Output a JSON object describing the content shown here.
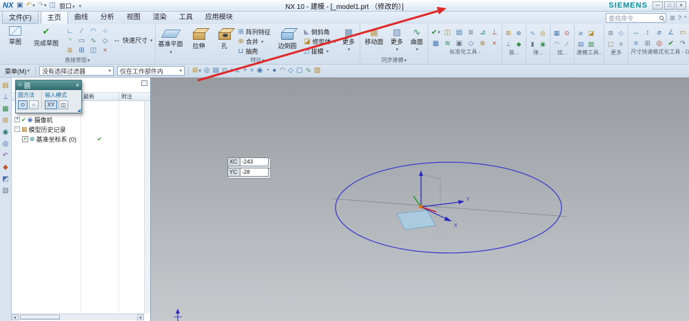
{
  "titlebar": {
    "logo": "NX",
    "quick_icons": [
      {
        "name": "save-icon",
        "glyph": "▣",
        "color": "#4a6fa5"
      },
      {
        "name": "undo-icon",
        "glyph": "↶",
        "color": "#caa23a",
        "caret": true
      },
      {
        "name": "redo-icon",
        "glyph": "↷",
        "color": "#9aa6b4",
        "caret": true
      },
      {
        "name": "window-switch-icon",
        "glyph": "◫",
        "color": "#6a86a8"
      }
    ],
    "window_menu": "窗口",
    "title": "NX 10 - 建模 - [_model1.prt （修改的）]",
    "brand": "SIEMENS",
    "window_controls": [
      {
        "name": "minimize-button",
        "glyph": "─"
      },
      {
        "name": "maximize-button",
        "glyph": "□"
      },
      {
        "name": "close-button",
        "glyph": "×"
      }
    ]
  },
  "tabs": [
    {
      "label": "文件(F)",
      "state": "file"
    },
    {
      "label": "主页",
      "state": "active"
    },
    {
      "label": "曲线",
      "state": ""
    },
    {
      "label": "分析",
      "state": ""
    },
    {
      "label": "视图",
      "state": ""
    },
    {
      "label": "渲染",
      "state": ""
    },
    {
      "label": "工具",
      "state": ""
    },
    {
      "label": "应用模块",
      "state": ""
    }
  ],
  "search": {
    "placeholder": "查找命令"
  },
  "tabrow_icons": [
    {
      "name": "command-finder-icon",
      "glyph": "⊞",
      "color": "#6a7a8a"
    },
    {
      "name": "help-icon",
      "glyph": "?",
      "color": "#4a6fa5"
    },
    {
      "name": "minimize-ribbon-icon",
      "glyph": "^",
      "color": "#6a7a8a"
    }
  ],
  "ribbon": {
    "sketch": {
      "sketch_label": "草图",
      "finish_label": "完成草图",
      "finish_glyph": "✔",
      "quick_dim_label": "快速尺寸",
      "quick_dim_glyph": "↔",
      "group_label": "直接草图",
      "grid_icons": [
        {
          "name": "profile-icon",
          "glyph": "∟",
          "color": "#3a7ab5"
        },
        {
          "name": "line-icon",
          "glyph": "∕",
          "color": "#3a7ab5"
        },
        {
          "name": "arc-icon",
          "glyph": "◠",
          "color": "#3a7ab5"
        },
        {
          "name": "circle-icon",
          "glyph": "○",
          "color": "#3a7ab5"
        },
        {
          "name": "fillet-icon",
          "glyph": "◝",
          "color": "#2a8a4a"
        },
        {
          "name": "rectangle-icon",
          "glyph": "▭",
          "color": "#3a7ab5"
        },
        {
          "name": "studio-spline-icon",
          "glyph": "∿",
          "color": "#2a8a4a"
        },
        {
          "name": "polygon-icon",
          "glyph": "◇",
          "color": "#3a7ab5"
        },
        {
          "name": "offset-curve-icon",
          "glyph": "≣",
          "color": "#b5862a"
        },
        {
          "name": "pattern-curve-icon",
          "glyph": "⊞",
          "color": "#3a7ab5"
        },
        {
          "name": "mirror-curve-icon",
          "glyph": "◫",
          "color": "#3a7ab5"
        },
        {
          "name": "trim-curve-icon",
          "glyph": "×",
          "color": "#b5432a"
        }
      ]
    },
    "feature": {
      "datum_plane": "基准平面",
      "extrude": "拉伸",
      "hole": "孔",
      "pattern": "阵列特征",
      "pattern_glyph": "⊞",
      "unite": "合并",
      "unite_glyph": "⊕",
      "shell": "抽壳",
      "shell_glyph": "⊔",
      "edge_blend": "边倒圆",
      "chamfer": "倒斜角",
      "chamfer_glyph": "◣",
      "trim_body": "修剪体",
      "trim_glyph": "◪",
      "draft": "拔模",
      "draft_glyph": "◿",
      "more": "更多",
      "more_glyph": "▦",
      "group_label": "特征"
    },
    "sync": {
      "move_face": "移动面",
      "move_face_glyph": "▦",
      "more": "更多",
      "more_glyph": "▧",
      "surface": "曲面",
      "surface_glyph": "∿",
      "group_label": "同步建模"
    },
    "std": {
      "group_label": "标准化工具 -",
      "row1": [
        {
          "name": "standard-check-icon",
          "glyph": "✔",
          "color": "#2a8a2a",
          "caret": true
        },
        {
          "name": "replace-template-icon",
          "glyph": "◫",
          "color": "#b5862a"
        },
        {
          "name": "part-family-icon",
          "glyph": "▤",
          "color": "#4a7ab0"
        },
        {
          "name": "attribute-tool-icon",
          "glyph": "≣",
          "color": "#6a7a8a"
        },
        {
          "name": "weld-assistant-icon",
          "glyph": "⊿",
          "color": "#2a7a7a"
        },
        {
          "name": "datum-tool-icon",
          "glyph": "⊥",
          "color": "#b5432a"
        }
      ],
      "row2": [
        {
          "name": "gb-standard-icon",
          "glyph": "▦",
          "color": "#4a7ab0"
        },
        {
          "name": "spline-tool-icon",
          "glyph": "≋",
          "color": "#2a8a4a"
        },
        {
          "name": "annotation-tool-icon",
          "glyph": "▣",
          "color": "#6a7a8a"
        },
        {
          "name": "symmetry-tool-icon",
          "glyph": "◇",
          "color": "#4a7ab0"
        },
        {
          "name": "scale-tool-icon",
          "glyph": "⊗",
          "color": "#b5862a"
        },
        {
          "name": "cleanup-tool-icon",
          "glyph": "×",
          "color": "#b5432a"
        }
      ]
    },
    "mini_groups": [
      {
        "label": "装...",
        "icons": [
          {
            "name": "add-component-icon",
            "glyph": "⊞",
            "color": "#b5862a"
          },
          {
            "name": "move-component-icon",
            "glyph": "⊕",
            "color": "#4a7ab0"
          },
          {
            "name": "assembly-constraint-icon",
            "glyph": "⊥",
            "color": "#4a7ab0"
          },
          {
            "name": "exploded-view-icon",
            "glyph": "◆",
            "color": "#3a8a4a"
          }
        ]
      },
      {
        "label": "弹...",
        "icons": [
          {
            "name": "spring-tool-icon",
            "glyph": "∿",
            "color": "#4a7ab0"
          },
          {
            "name": "gear-tool-icon",
            "glyph": "◎",
            "color": "#b5862a"
          },
          {
            "name": "bolt-tool-icon",
            "glyph": "▮",
            "color": "#6a7a8a"
          },
          {
            "name": "cam-tool-icon",
            "glyph": "◉",
            "color": "#3a8a4a"
          }
        ]
      },
      {
        "label": "加...",
        "icons": [
          {
            "name": "mill-tool-icon",
            "glyph": "▦",
            "color": "#4a7ab0"
          },
          {
            "name": "drill-tool-icon",
            "glyph": "⊙",
            "color": "#b5432a"
          },
          {
            "name": "turn-tool-icon",
            "glyph": "◠",
            "color": "#4a7ab0"
          },
          {
            "name": "wire-edm-icon",
            "glyph": "∕",
            "color": "#6a7a8a"
          }
        ]
      },
      {
        "label": "建模工具..",
        "icons": [
          {
            "name": "measure-icon",
            "glyph": "⌀",
            "color": "#4a7ab0"
          },
          {
            "name": "section-view-icon",
            "glyph": "◪",
            "color": "#b5862a"
          },
          {
            "name": "layer-settings-icon",
            "glyph": "▤",
            "color": "#4a7ab0"
          },
          {
            "name": "object-display-icon",
            "glyph": "▧",
            "color": "#3a8a4a"
          }
        ]
      },
      {
        "label": "更多",
        "icons": [
          {
            "name": "more-tools-icon-1",
            "glyph": "⊞",
            "color": "#6a7a8a"
          },
          {
            "name": "more-tools-icon-2",
            "glyph": "◇",
            "color": "#4a7ab0"
          },
          {
            "name": "more-tools-icon-3",
            "glyph": "▢",
            "color": "#b5862a"
          },
          {
            "name": "more-tools-icon-4",
            "glyph": "≡",
            "color": "#6a7a8a"
          }
        ]
      }
    ],
    "gc": {
      "group_label": "尺寸快速格式化工具 - GC工具箱",
      "row1": [
        {
          "name": "style-dim-icon",
          "glyph": "↔",
          "color": "#2a7a7a"
        },
        {
          "name": "vertical-dim-icon",
          "glyph": "↕",
          "color": "#2a7a7a"
        },
        {
          "name": "diameter-dim-icon",
          "glyph": "⌀",
          "color": "#4a7ab0"
        },
        {
          "name": "angle-dim-icon",
          "glyph": "∠",
          "color": "#4a7ab0"
        },
        {
          "name": "frame-tool-icon",
          "glyph": "▭",
          "color": "#b5862a"
        }
      ],
      "row2": [
        {
          "name": "align-tool-icon",
          "glyph": "≡",
          "color": "#4a7ab0"
        },
        {
          "name": "table-tool-icon",
          "glyph": "⊞",
          "color": "#6a7a8a"
        },
        {
          "name": "target-tool-icon",
          "glyph": "◎",
          "color": "#b5432a"
        },
        {
          "name": "check-dim-icon",
          "glyph": "✔",
          "color": "#2a8a2a"
        },
        {
          "name": "export-tool-icon",
          "glyph": "↷",
          "color": "#6a7a8a"
        }
      ]
    }
  },
  "selbar": {
    "menu_label": "菜单(M)",
    "filter_value": "没有选择过滤器",
    "scope_value": "仅在工作部件内",
    "icons": [
      {
        "name": "whole-assembly-icon",
        "glyph": "⊞",
        "color": "#b5862a",
        "caret": true
      },
      {
        "name": "highlight-related-icon",
        "glyph": "◎",
        "color": "#4a7ab0"
      },
      {
        "name": "top-level-only-icon",
        "glyph": "▤",
        "color": "#4a7ab0"
      },
      {
        "name": "snap-point-toggle-icon",
        "glyph": "⊙",
        "color": "#2a7a7a"
      },
      {
        "name": "end-point-icon",
        "glyph": "∕",
        "color": "#4a7ab0"
      },
      {
        "name": "mid-point-icon",
        "glyph": "⊥",
        "color": "#4a7ab0"
      },
      {
        "name": "control-point-icon",
        "glyph": "+",
        "color": "#4a7ab0"
      },
      {
        "name": "intersection-icon",
        "glyph": "×",
        "color": "#4a7ab0"
      },
      {
        "name": "arc-center-icon",
        "glyph": "◉",
        "color": "#4a7ab0"
      },
      {
        "name": "quadrant-point-icon",
        "glyph": "◔",
        "color": "#4a7ab0"
      },
      {
        "name": "existing-point-icon",
        "glyph": "●",
        "color": "#4a7ab0"
      },
      {
        "name": "point-on-curve-icon",
        "glyph": "◠",
        "color": "#4a7ab0"
      },
      {
        "name": "point-on-surface-icon",
        "glyph": "◇",
        "color": "#4a7ab0"
      },
      {
        "name": "bounded-plane-icon",
        "glyph": "▢",
        "color": "#4a7ab0"
      },
      {
        "name": "curve-rule-icon",
        "glyph": "∿",
        "color": "#2a8a4a"
      },
      {
        "name": "face-rule-icon",
        "glyph": "▧",
        "color": "#b5862a"
      }
    ]
  },
  "resourcebar": {
    "icons": [
      {
        "name": "assembly-navigator-icon",
        "glyph": "▤",
        "color": "#b5862a"
      },
      {
        "name": "constraint-navigator-icon",
        "glyph": "⊥",
        "color": "#4a6fa5"
      },
      {
        "name": "part-navigator-icon",
        "glyph": "▦",
        "color": "#3a8a4a"
      },
      {
        "name": "reuse-library-icon",
        "glyph": "⊞",
        "color": "#b5862a"
      },
      {
        "name": "hd3d-tools-icon",
        "glyph": "◉",
        "color": "#2a7a7a"
      },
      {
        "name": "web-browser-icon",
        "glyph": "◎",
        "color": "#2a5aaa"
      },
      {
        "name": "history-icon",
        "glyph": "↶",
        "color": "#7a5aa0"
      },
      {
        "name": "process-studio-icon",
        "glyph": "◆",
        "color": "#c05a2a"
      },
      {
        "name": "roles-icon",
        "glyph": "◩",
        "color": "#4a6fa5"
      },
      {
        "name": "system-scene-icon",
        "glyph": "▧",
        "color": "#6a7a8a"
      }
    ]
  },
  "dialog": {
    "title": "圆",
    "title_glyph": "○",
    "close_glyph": "×",
    "method_label": "圆方法",
    "input_label": "输入模式",
    "xy_label": "XY",
    "param_glyph": "◫",
    "method_icons": [
      {
        "name": "circle-center-radius-icon",
        "glyph": "⊙",
        "color": "#2a5a8a",
        "cls": "sel dbtn"
      },
      {
        "name": "circle-three-point-icon",
        "glyph": "○",
        "color": "#2a5a8a",
        "cls": "dbtn"
      }
    ]
  },
  "navigator": {
    "columns": [
      "最新",
      "附注"
    ],
    "rows": {
      "camera": {
        "expander": "+",
        "check": "✔",
        "icon": "◉",
        "label": "摄像机"
      },
      "history": {
        "expander": "-",
        "icon": "▦",
        "label": "模型历史记录"
      },
      "csys": {
        "check": "✔",
        "icon": "⊕",
        "label": "基准坐标系 (0)",
        "status": "✔"
      }
    }
  },
  "canvas": {
    "coords": {
      "x_label": "XC",
      "x_value": "-243",
      "y_label": "YC",
      "y_value": "-28"
    },
    "axes": {
      "x": "X",
      "y": "Y"
    },
    "colors": {
      "circle": "#3a3ace",
      "annotation": "#e02828"
    }
  }
}
